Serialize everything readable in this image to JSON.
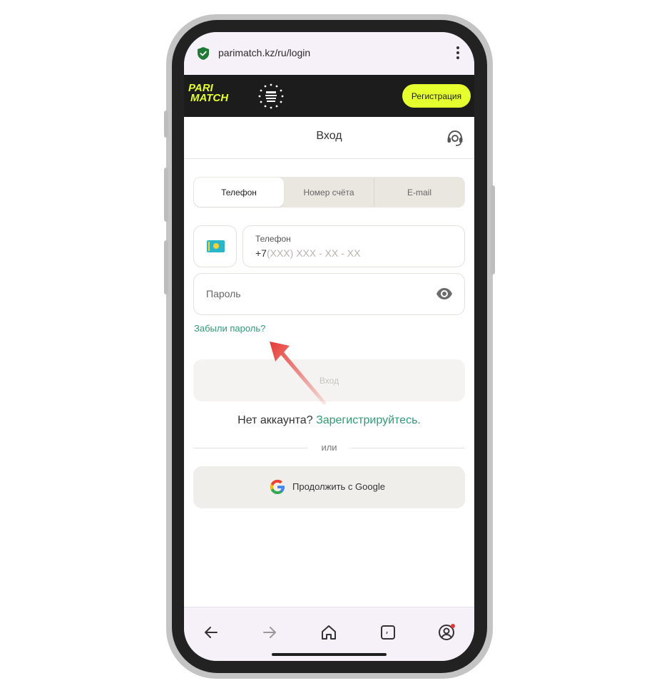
{
  "browser": {
    "url": "parimatch.kz/ru/login"
  },
  "header": {
    "logo_line1": "PARI",
    "logo_line2": "MATCH",
    "register_label": "Регистрация"
  },
  "page": {
    "title": "Вход",
    "tabs": [
      {
        "label": "Телефон",
        "active": true
      },
      {
        "label": "Номер счёта",
        "active": false
      },
      {
        "label": "E-mail",
        "active": false
      }
    ],
    "phone_label": "Телефон",
    "phone_prefix": "+7",
    "phone_placeholder": "(XXX) XXX - XX - XX",
    "password_placeholder": "Пароль",
    "forgot_password": "Забыли пароль?",
    "login_button": "Вход",
    "no_account_text": "Нет аккаунта?",
    "register_link": "Зарегистрируйтесь.",
    "or_text": "или",
    "google_button": "Продолжить с Google"
  },
  "colors": {
    "brand_yellow": "#e6ff2e",
    "link_green": "#2f9b74",
    "header_dark": "#1c1c1c",
    "annotation_arrow": "#e53935"
  },
  "icons": [
    "shield-check-icon",
    "kebab-menu-icon",
    "award-badge-icon",
    "support-headset-icon",
    "kazakhstan-flag-icon",
    "eye-icon",
    "google-icon",
    "back-arrow-icon",
    "forward-arrow-icon",
    "home-icon",
    "tabs-icon",
    "account-icon"
  ]
}
